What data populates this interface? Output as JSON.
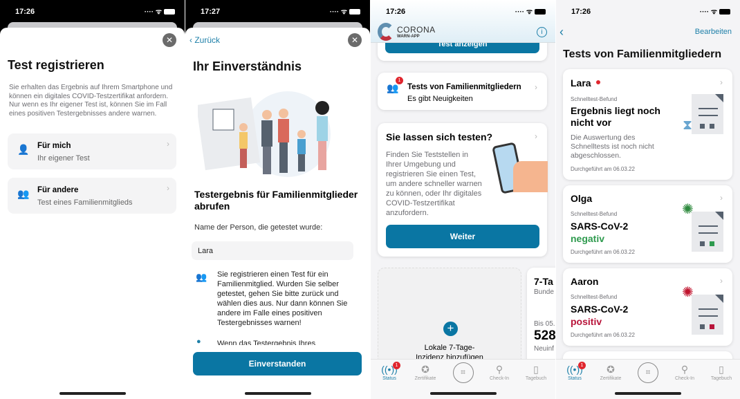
{
  "screen1": {
    "time": "17:26",
    "title": "Test registrieren",
    "description": "Sie erhalten das Ergebnis auf Ihrem Smartphone und können ein digitales COVID-Testzertifikat anfordern. Nur wenn es Ihr eigener Test ist, können Sie im Fall eines positiven Testergebnisses andere warnen.",
    "options": [
      {
        "title": "Für mich",
        "subtitle": "Ihr eigener Test",
        "icon": "person-icon"
      },
      {
        "title": "Für andere",
        "subtitle": "Test eines Familienmitglieds",
        "icon": "group-icon"
      }
    ]
  },
  "screen2": {
    "time": "17:27",
    "back": "Zurück",
    "title": "Ihr Einverständnis",
    "subtitle": "Testergebnis für Familienmitglieder abrufen",
    "name_label": "Name der Person, die getestet wurde:",
    "name_value": "Lara",
    "info1": "Sie registrieren einen Test für ein Familienmitglied. Wurden Sie selber getestet, gehen Sie bitte zurück und wählen dies aus. Nur dann können Sie andere im Falle eines positiven Testergebnisses warnen!",
    "info2": "Wenn das Testergebnis Ihres",
    "button": "Einverstanden"
  },
  "screen3": {
    "time": "17:26",
    "logo_top": "CORONA",
    "logo_bottom": "WARN-APP",
    "prev_button": "Test anzeigen",
    "family": {
      "title": "Tests von Familienmitgliedern",
      "subtitle": "Es gibt Neuigkeiten",
      "badge": "1"
    },
    "test_card": {
      "title": "Sie lassen sich testen?",
      "text": "Finden Sie Teststellen in Ihrer Umgebung und registrieren Sie einen Test, um andere schneller warnen zu können, oder Ihr digitales COVID-Testzertifikat anzufordern.",
      "button": "Weiter"
    },
    "add_incidence": "Lokale 7-Tage-Inzidenz hinzufügen",
    "incidence": {
      "title": "7-Ta",
      "sub": "Bunde",
      "date": "Bis 05.",
      "value": "528",
      "unit": "Neuinf"
    }
  },
  "screen4": {
    "time": "17:26",
    "edit": "Bearbeiten",
    "title": "Tests von Familienmitgliedern",
    "tests": [
      {
        "name": "Lara",
        "type": "Schnelltest-Befund",
        "result": "Ergebnis liegt noch nicht vor",
        "detail": "Die Auswertung des Schnelltests ist noch nicht abgeschlossen.",
        "date": "Durchgeführt am 06.03.22",
        "status": "pending",
        "unread": true
      },
      {
        "name": "Olga",
        "type": "Schnelltest-Befund",
        "result": "SARS-CoV-2",
        "verdict": "negativ",
        "date": "Durchgeführt am 06.03.22",
        "status": "negative",
        "color": "#2e9a4e"
      },
      {
        "name": "Aaron",
        "type": "Schnelltest-Befund",
        "result": "SARS-CoV-2",
        "verdict": "positiv",
        "date": "Durchgeführt am 06.03.22",
        "status": "positive",
        "color": "#b8143a"
      }
    ]
  },
  "tabbar": {
    "items": [
      "Status",
      "Zertifikate",
      "Check-In",
      "Tagebuch"
    ],
    "status_badge": "1"
  },
  "colors": {
    "accent": "#0a76a3",
    "negative": "#2e9a4e",
    "positive": "#b8143a",
    "badge": "#e0262e"
  }
}
